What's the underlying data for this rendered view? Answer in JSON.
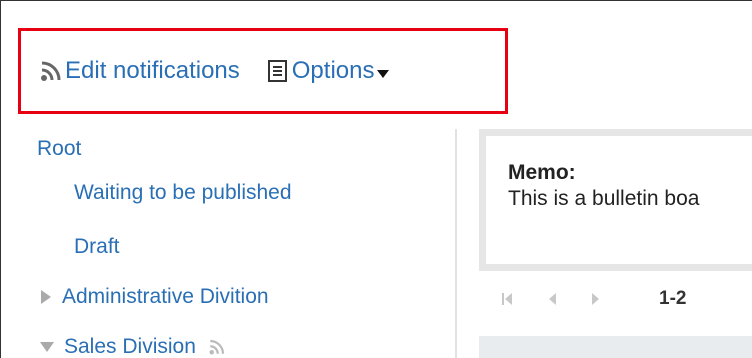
{
  "toolbar": {
    "edit_notifications": "Edit notifications",
    "options": "Options",
    "icons": {
      "edit_notifications": "rss-feed-icon",
      "options": "list-document-icon",
      "options_caret": "caret-down-icon"
    }
  },
  "tree": {
    "items": [
      {
        "label": "Root",
        "arrow": "none"
      },
      {
        "label": "Waiting to be published",
        "arrow": "none"
      },
      {
        "label": "Draft",
        "arrow": "none"
      },
      {
        "label": "Administrative Divition",
        "arrow": "collapsed"
      },
      {
        "label": "Sales Division",
        "arrow": "expanded",
        "feed_icon": "rss-feed-icon"
      }
    ]
  },
  "memo": {
    "title": "Memo:",
    "text": "This is a bulletin boa"
  },
  "pager": {
    "range": "1-2"
  },
  "colors": {
    "link": "#2a6fb5",
    "highlight": "#e60012",
    "memo_border": "#e6e6e6",
    "text": "#222222"
  }
}
